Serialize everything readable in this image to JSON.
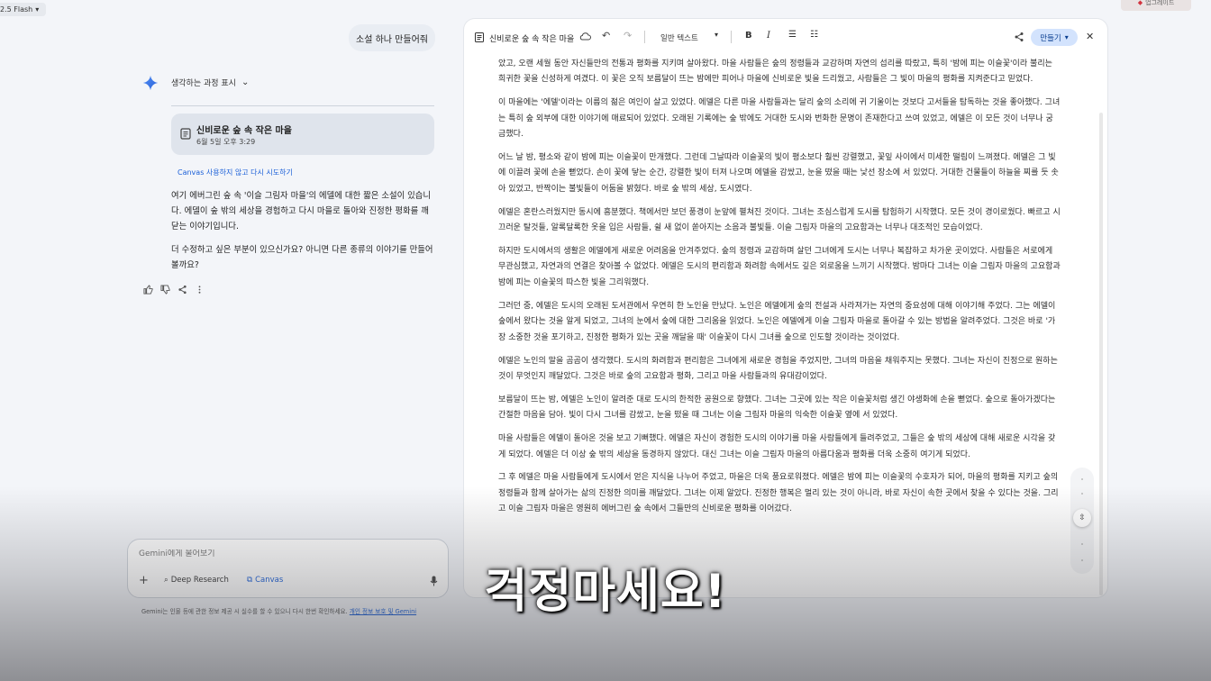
{
  "model_selector": {
    "label": "2.5 Flash"
  },
  "upgrade": {
    "label": "업그레이드"
  },
  "chat": {
    "user_message": "소설 하나 만들어줘",
    "thinking_label": "생각하는 과정 표시",
    "doc_card": {
      "title": "신비로운 숲 속 작은 마을",
      "date": "6월 5일 오후 3:29"
    },
    "retry_label": "Canvas 사용하지 않고 다시 시도하기",
    "answer": [
      "여기 에버그린 숲 속 '이슬 그림자 마을'의 에델에 대한 짧은 소설이 있습니다. 에델이 숲 밖의 세상을 경험하고 다시 마을로 돌아와 진정한 평화를 깨닫는 이야기입니다.",
      "더 수정하고 싶은 부분이 있으신가요? 아니면 다른 종류의 이야기를 만들어 볼까요?"
    ]
  },
  "prompt": {
    "placeholder": "Gemini에게 물어보기",
    "deep_research": "Deep Research",
    "canvas": "Canvas",
    "disclaimer": "Gemini는 인물 등에 관한 정보 제공 시 실수를 할 수 있으니 다시 한번 확인하세요. ",
    "privacy_link": "개인 정보 보호 및 Gemini"
  },
  "canvas": {
    "title": "신비로운 숲 속 작은 마을",
    "text_style": "일반 텍스트",
    "make_button": "만들기",
    "paragraphs": [
      "았고, 오랜 세월 동안 자신들만의 전통과 평화를 지키며 살아왔다. 마을 사람들은 숲의 정령들과 교감하며 자연의 섭리를 따랐고, 특히 '밤에 피는 이슬꽃'이라 불리는 희귀한 꽃을 신성하게 여겼다. 이 꽃은 오직 보름달이 뜨는 밤에만 피어나 마을에 신비로운 빛을 드리웠고, 사람들은 그 빛이 마을의 평화를 지켜준다고 믿었다.",
      "이 마을에는 '에델'이라는 이름의 젊은 여인이 살고 있었다. 에델은 다른 마을 사람들과는 달리 숲의 소리에 귀 기울이는 것보다 고서들을 탐독하는 것을 좋아했다. 그녀는 특히 숲 외부에 대한 이야기에 매료되어 있었다. 오래된 기록에는 숲 밖에도 거대한 도시와 번화한 문명이 존재한다고 쓰여 있었고, 에델은 이 모든 것이 너무나 궁금했다.",
      "어느 날 밤, 평소와 같이 밤에 피는 이슬꽃이 만개했다. 그런데 그날따라 이슬꽃의 빛이 평소보다 훨씬 강렬했고, 꽃잎 사이에서 미세한 떨림이 느껴졌다. 에델은 그 빛에 이끌려 꽃에 손을 뻗었다. 손이 꽃에 닿는 순간, 강렬한 빛이 터져 나오며 에델을 감쌌고, 눈을 떴을 때는 낯선 장소에 서 있었다. 거대한 건물들이 하늘을 찌를 듯 솟아 있었고, 반짝이는 불빛들이 어둠을 밝혔다. 바로 숲 밖의 세상, 도시였다.",
      "에델은 혼란스러웠지만 동시에 흥분했다. 책에서만 보던 풍경이 눈앞에 펼쳐진 것이다. 그녀는 조심스럽게 도시를 탐험하기 시작했다. 모든 것이 경이로웠다. 빠르고 시끄러운 탈것들, 알록달록한 옷을 입은 사람들, 쉴 새 없이 쏟아지는 소음과 불빛들. 이슬 그림자 마을의 고요함과는 너무나 대조적인 모습이었다.",
      "하지만 도시에서의 생활은 에델에게 새로운 어려움을 안겨주었다. 숲의 정령과 교감하며 살던 그녀에게 도시는 너무나 복잡하고 차가운 곳이었다. 사람들은 서로에게 무관심했고, 자연과의 연결은 찾아볼 수 없었다. 에델은 도시의 편리함과 화려함 속에서도 깊은 외로움을 느끼기 시작했다. 밤마다 그녀는 이슬 그림자 마을의 고요함과 밤에 피는 이슬꽃의 따스한 빛을 그리워했다.",
      "그러던 중, 에델은 도시의 오래된 도서관에서 우연히 한 노인을 만났다. 노인은 에델에게 숲의 전설과 사라져가는 자연의 중요성에 대해 이야기해 주었다. 그는 에델이 숲에서 왔다는 것을 알게 되었고, 그녀의 눈에서 숲에 대한 그리움을 읽었다. 노인은 에델에게 이슬 그림자 마을로 돌아갈 수 있는 방법을 알려주었다. 그것은 바로 '가장 소중한 것을 포기하고, 진정한 평화가 있는 곳을 깨달을 때' 이슬꽃이 다시 그녀를 숲으로 인도할 것이라는 것이었다.",
      "에델은 노인의 말을 곰곰이 생각했다. 도시의 화려함과 편리함은 그녀에게 새로운 경험을 주었지만, 그녀의 마음을 채워주지는 못했다. 그녀는 자신이 진정으로 원하는 것이 무엇인지 깨달았다. 그것은 바로 숲의 고요함과 평화, 그리고 마을 사람들과의 유대감이었다.",
      "보름달이 뜨는 밤, 에델은 노인이 알려준 대로 도시의 한적한 공원으로 향했다. 그녀는 그곳에 있는 작은 이슬꽃처럼 생긴 야생화에 손을 뻗었다. 숲으로 돌아가겠다는 간절한 마음을 담아. 빛이 다시 그녀를 감쌌고, 눈을 떴을 때 그녀는 이슬 그림자 마을의 익숙한 이슬꽃 옆에 서 있었다.",
      "마을 사람들은 에델이 돌아온 것을 보고 기뻐했다. 에델은 자신이 경험한 도시의 이야기를 마을 사람들에게 들려주었고, 그들은 숲 밖의 세상에 대해 새로운 시각을 갖게 되었다. 에델은 더 이상 숲 밖의 세상을 동경하지 않았다. 대신 그녀는 이슬 그림자 마을의 아름다움과 평화를 더욱 소중히 여기게 되었다.",
      "그 후 에델은 마을 사람들에게 도시에서 얻은 지식을 나누어 주었고, 마을은 더욱 풍요로워졌다. 에델은 밤에 피는 이슬꽃의 수호자가 되어, 마을의 평화를 지키고 숲의 정령들과 함께 살아가는 삶의 진정한 의미를 깨달았다. 그녀는 이제 알았다. 진정한 행복은 멀리 있는 것이 아니라, 바로 자신이 속한 곳에서 찾을 수 있다는 것을. 그리고 이슬 그림자 마을은 영원히 에버그린 숲 속에서 그들만의 신비로운 평화를 이어갔다."
    ]
  },
  "subtitle": "걱정마세요!",
  "colors": {
    "accent": "#1a5fd8",
    "make_button_bg": "#d3e3fd",
    "doc_card_bg": "#dfe4ec"
  }
}
